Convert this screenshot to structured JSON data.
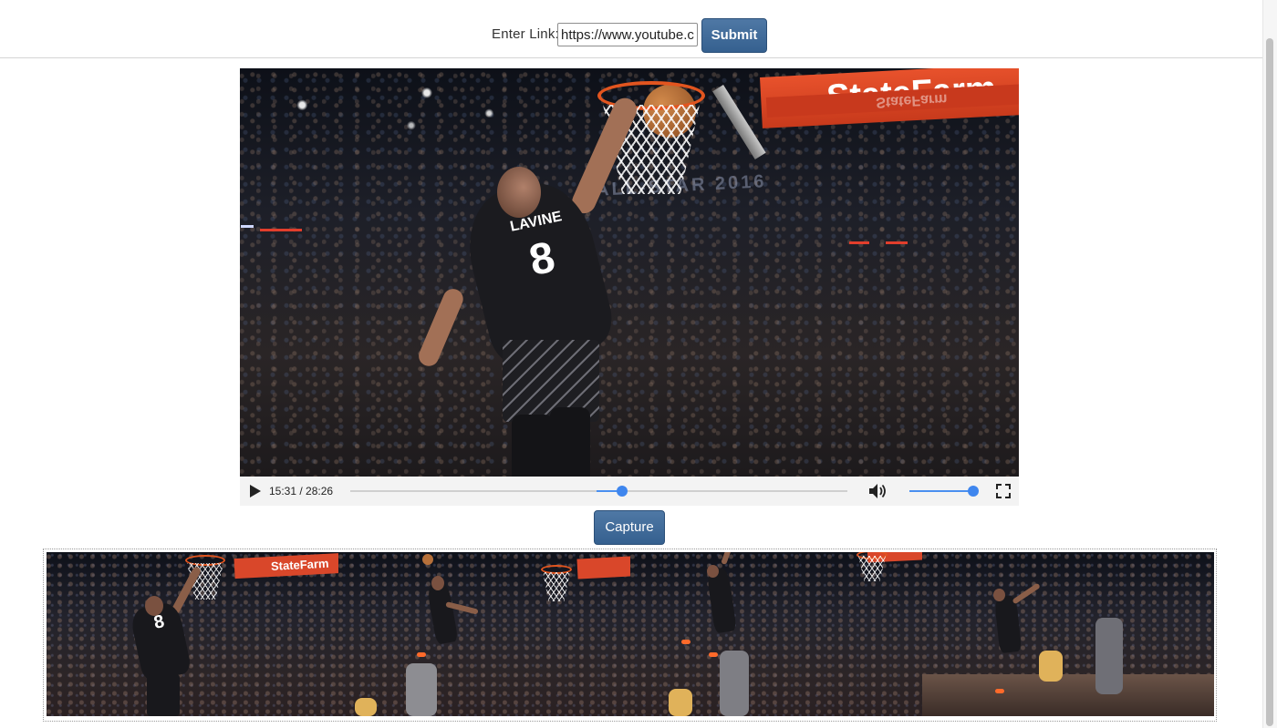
{
  "header": {
    "link_label": "Enter Link:",
    "link_value": "https://www.youtube.com/watch",
    "submit_label": "Submit"
  },
  "video": {
    "banner_text": "StateFarm",
    "banner_subtext": "StateFarm",
    "jersey_name": "LAVINE",
    "jersey_number": "8",
    "arena_text": "ALL-STAR  2016",
    "current_time": "15:31",
    "separator": " / ",
    "duration": "28:26",
    "progress": 0.546,
    "volume": 1.0
  },
  "capture": {
    "button_label": "Capture",
    "frames": [
      {
        "banner_text": "StateFarm",
        "jersey_number": "8"
      },
      {
        "banner_text": ""
      },
      {
        "banner_text": ""
      },
      {
        "banner_text": ""
      }
    ]
  },
  "colors": {
    "accent": "#3f86ee",
    "button": "#3d6794",
    "banner": "#e8522c"
  },
  "icons": [
    "play-icon",
    "volume-icon",
    "fullscreen-icon"
  ]
}
